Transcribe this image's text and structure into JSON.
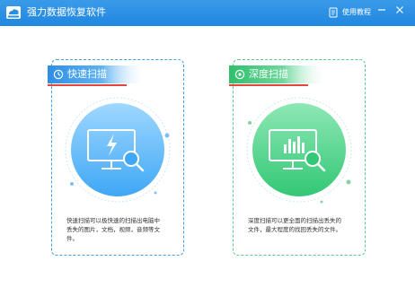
{
  "window": {
    "title": "强力数据恢复软件",
    "guide_label": "使用教程",
    "brand_color": "#1f86e0"
  },
  "icons": {
    "app": "cloud-drive-icon",
    "guide": "book-icon",
    "minimize": "minimize-icon",
    "close": "close-icon",
    "quick": "clock-icon",
    "deep": "target-icon",
    "quick_visual": "monitor-lightning-search-icon",
    "deep_visual": "monitor-bars-search-icon"
  },
  "modes": {
    "quick": {
      "label": "快速扫描",
      "desc_line1": "快速扫描可以极快速的扫描出电脑中",
      "desc_line2": "丢失的图片，文档，视频，音频等文",
      "desc_line3": "件。",
      "accent": "#3f9ee9"
    },
    "deep": {
      "label": "深度扫描",
      "desc_line1": "深度扫描可以更全面的扫描出丢失的",
      "desc_line2": "文件，最大程度的找回丢失的文件。",
      "accent": "#4ccb85"
    }
  }
}
